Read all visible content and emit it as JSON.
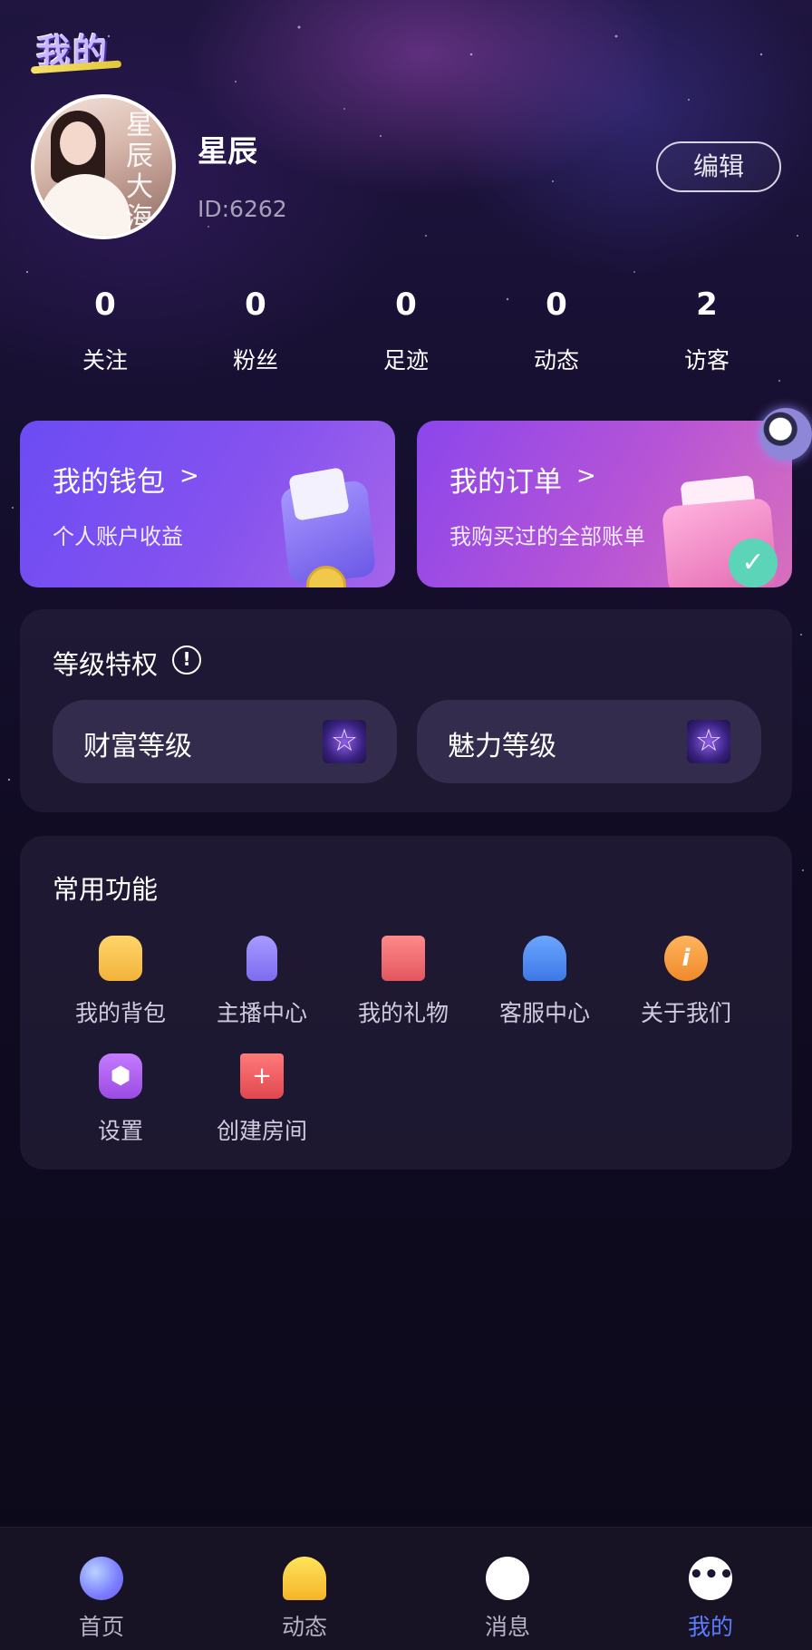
{
  "header": {
    "title": "我的"
  },
  "profile": {
    "name": "星辰",
    "id_label": "ID:6262",
    "edit_label": "编辑",
    "avatar_text": "星辰大海"
  },
  "stats": [
    {
      "value": "0",
      "label": "关注"
    },
    {
      "value": "0",
      "label": "粉丝"
    },
    {
      "value": "0",
      "label": "足迹"
    },
    {
      "value": "0",
      "label": "动态"
    },
    {
      "value": "2",
      "label": "访客"
    }
  ],
  "cards": {
    "wallet": {
      "title": "我的钱包",
      "subtitle": "个人账户收益",
      "chevron": ">"
    },
    "order": {
      "title": "我的订单",
      "subtitle": "我购买过的全部账单",
      "chevron": ">"
    }
  },
  "level": {
    "title": "等级特权",
    "info_icon": "!",
    "items": [
      {
        "label": "财富等级",
        "icon": "star-badge-icon"
      },
      {
        "label": "魅力等级",
        "icon": "star-badge-icon"
      }
    ]
  },
  "functions": {
    "title": "常用功能",
    "items": [
      {
        "label": "我的背包",
        "icon": "backpack-icon"
      },
      {
        "label": "主播中心",
        "icon": "microphone-icon"
      },
      {
        "label": "我的礼物",
        "icon": "gift-icon"
      },
      {
        "label": "客服中心",
        "icon": "customer-service-icon"
      },
      {
        "label": "关于我们",
        "icon": "info-icon"
      },
      {
        "label": "设置",
        "icon": "settings-icon"
      },
      {
        "label": "创建房间",
        "icon": "create-room-icon"
      }
    ]
  },
  "tabbar": {
    "items": [
      {
        "label": "首页",
        "icon": "heart-icon"
      },
      {
        "label": "动态",
        "icon": "bell-icon"
      },
      {
        "label": "消息",
        "icon": "message-icon"
      },
      {
        "label": "我的",
        "icon": "more-dots-icon"
      }
    ],
    "active": "我的",
    "active_color": "#5c7cff"
  }
}
